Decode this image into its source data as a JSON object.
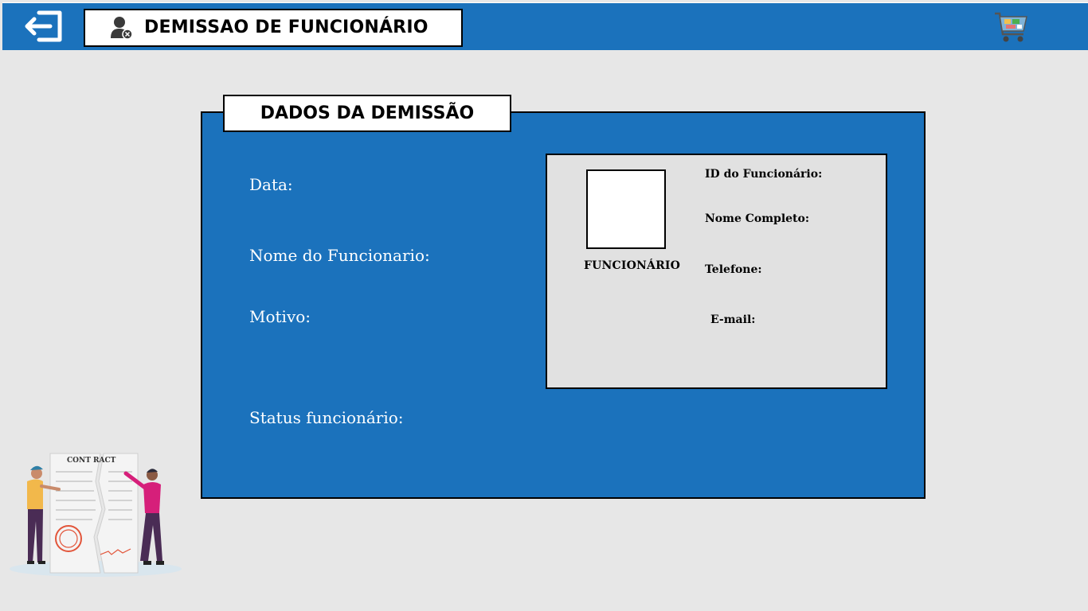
{
  "header": {
    "title": "DEMISSAO DE FUNCIONÁRIO",
    "exit_icon": "exit-icon",
    "user_icon": "user-remove-icon",
    "cart_icon": "shopping-cart-icon",
    "colors": {
      "bar": "#1b72bc",
      "background": "#e7e7e7"
    }
  },
  "panel": {
    "title": "DADOS DA DEMISSÃO",
    "fields": {
      "data": "Data:",
      "nome": "Nome do Funcionario:",
      "motivo": "Motivo:",
      "status": "Status funcionário:"
    }
  },
  "card": {
    "photo_label": "FUNCIONÁRIO",
    "id_label": "ID do Funcionário:",
    "nome_label": "Nome Completo:",
    "telefone_label": "Telefone:",
    "email_label": "E-mail:"
  },
  "illustration": {
    "contract_text": "CONT RACT",
    "icon": "torn-contract-illustration"
  }
}
